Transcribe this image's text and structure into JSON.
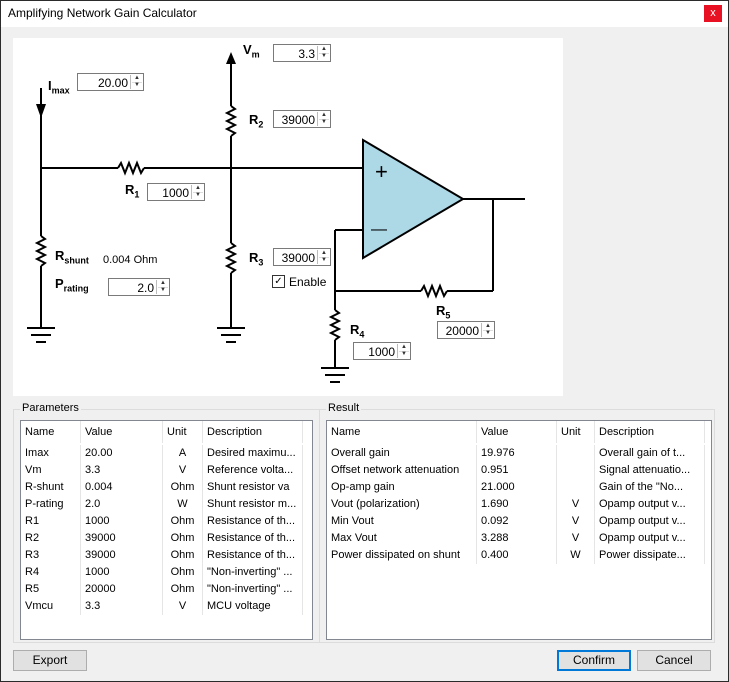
{
  "window": {
    "title": "Amplifying Network Gain Calculator",
    "close_glyph": "x"
  },
  "diagram": {
    "imax": {
      "label": "I",
      "sub": "max",
      "value": "20.00"
    },
    "vm": {
      "label": "V",
      "sub": "m",
      "value": "3.3"
    },
    "r1": {
      "label": "R",
      "sub": "1",
      "value": "1000"
    },
    "r2": {
      "label": "R",
      "sub": "2",
      "value": "39000"
    },
    "r3": {
      "label": "R",
      "sub": "3",
      "value": "39000"
    },
    "r4": {
      "label": "R",
      "sub": "4",
      "value": "1000"
    },
    "r5": {
      "label": "R",
      "sub": "5",
      "value": "20000"
    },
    "rshunt": {
      "label": "R",
      "sub": "shunt",
      "value_text": "0.004 Ohm"
    },
    "prating": {
      "label": "P",
      "sub": "rating",
      "value": "2.0"
    },
    "enable_label": "Enable",
    "enable_checked": true,
    "opamp_plus": "+",
    "opamp_minus": "—"
  },
  "parameters": {
    "title": "Parameters",
    "columns": [
      "Name",
      "Value",
      "Unit",
      "Description"
    ],
    "rows": [
      [
        "Imax",
        "20.00",
        "A",
        "Desired maximu..."
      ],
      [
        "Vm",
        "3.3",
        "V",
        "Reference volta..."
      ],
      [
        "R-shunt",
        "0.004",
        "Ohm",
        "Shunt resistor va"
      ],
      [
        "P-rating",
        "2.0",
        "W",
        "Shunt resistor m..."
      ],
      [
        "R1",
        "1000",
        "Ohm",
        "Resistance of th..."
      ],
      [
        "R2",
        "39000",
        "Ohm",
        "Resistance of th..."
      ],
      [
        "R3",
        "39000",
        "Ohm",
        "Resistance of th..."
      ],
      [
        "R4",
        "1000",
        "Ohm",
        "\"Non-inverting\" ..."
      ],
      [
        "R5",
        "20000",
        "Ohm",
        "\"Non-inverting\" ..."
      ],
      [
        "Vmcu",
        "3.3",
        "V",
        "MCU voltage"
      ]
    ]
  },
  "result": {
    "title": "Result",
    "columns": [
      "Name",
      "Value",
      "Unit",
      "Description"
    ],
    "rows": [
      [
        "Overall gain",
        "19.976",
        "",
        "Overall gain of t..."
      ],
      [
        "Offset network attenuation",
        "0.951",
        "",
        "Signal attenuatio..."
      ],
      [
        "Op-amp gain",
        "21.000",
        "",
        "Gain of the \"No..."
      ],
      [
        "Vout (polarization)",
        "1.690",
        "V",
        "Opamp output v..."
      ],
      [
        "Min Vout",
        "0.092",
        "V",
        "Opamp output v..."
      ],
      [
        "Max Vout",
        "3.288",
        "V",
        "Opamp output v..."
      ],
      [
        "Power dissipated on shunt",
        "0.400",
        "W",
        "Power dissipate..."
      ]
    ]
  },
  "buttons": {
    "export": "Export",
    "confirm": "Confirm",
    "cancel": "Cancel"
  },
  "colors": {
    "opamp_fill": "#add8e6",
    "close_bg": "#e81123",
    "accent": "#0078d7"
  }
}
